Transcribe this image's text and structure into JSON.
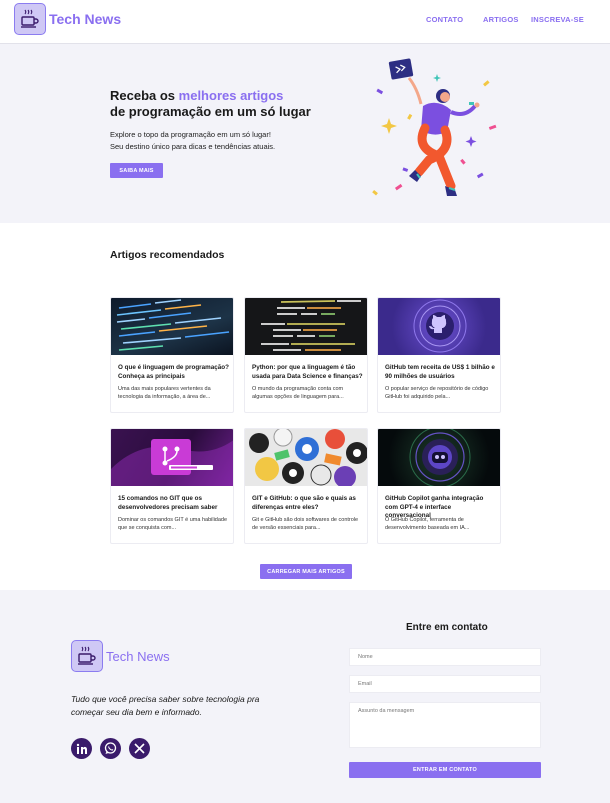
{
  "header": {
    "logo_text": "Tech News",
    "nav": [
      "CONTATO",
      "ARTIGOS",
      "INSCREVA-SE"
    ]
  },
  "hero": {
    "title_prefix": "Receba os ",
    "title_accent": "melhores artigos",
    "title_line2": "de programação em um só lugar",
    "desc_line1": "Explore o topo da programação em um só lugar!",
    "desc_line2": "Seu destino único para dicas e tendências atuais.",
    "button": "SAIBA MAIS"
  },
  "articles": {
    "title": "Artigos recomendados",
    "cards": [
      {
        "title": "O que é linguagem de programação? Conheça as principais",
        "desc": "Uma das mais populares vertentes da tecnologia da informação, a área de...",
        "image": "code-screen"
      },
      {
        "title": "Python: por que a linguagem é tão usada para Data Science e finanças?",
        "desc": "O mundo da programação conta com algumas opções de linguagem para...",
        "image": "python-code"
      },
      {
        "title": "GitHub tem receita de US$ 1 bilhão e 90 milhões de usuários",
        "desc": "O popular serviço de repositório de código GitHub foi adquirido pela...",
        "image": "github-logo"
      },
      {
        "title": "15 comandos no GIT que os desenvolvedores precisam saber",
        "desc": "Dominar os comandos GIT é uma habilidade que se conquista com...",
        "image": "git-branch"
      },
      {
        "title": "GIT e GitHub: o que são e quais as diferenças entre eles?",
        "desc": "Git e GitHub são dois softwares de controle de versão essenciais para...",
        "image": "stickers"
      },
      {
        "title": "GitHub Copilot ganha integração com GPT-4 e interface conversacional",
        "desc": "O GitHub Copilot, ferramenta de desenvolvimento baseada em IA...",
        "image": "copilot"
      }
    ],
    "load_more": "CARREGAR MAIS ARTIGOS"
  },
  "footer": {
    "logo_text": "Tech News",
    "tagline": "Tudo que você precisa saber sobre tecnologia pra começar seu dia bem e informado.",
    "social": [
      "linkedin-icon",
      "whatsapp-icon",
      "x-icon"
    ],
    "contact": {
      "title": "Entre em contato",
      "name_placeholder": "Nome",
      "email_placeholder": "Email",
      "message_placeholder": "Assunto da mensagem",
      "button": "ENTRAR EM CONTATO"
    }
  },
  "colors": {
    "accent": "#8a6ff0",
    "dark_purple": "#3a1b6b",
    "section_bg": "#f3f3f9"
  }
}
